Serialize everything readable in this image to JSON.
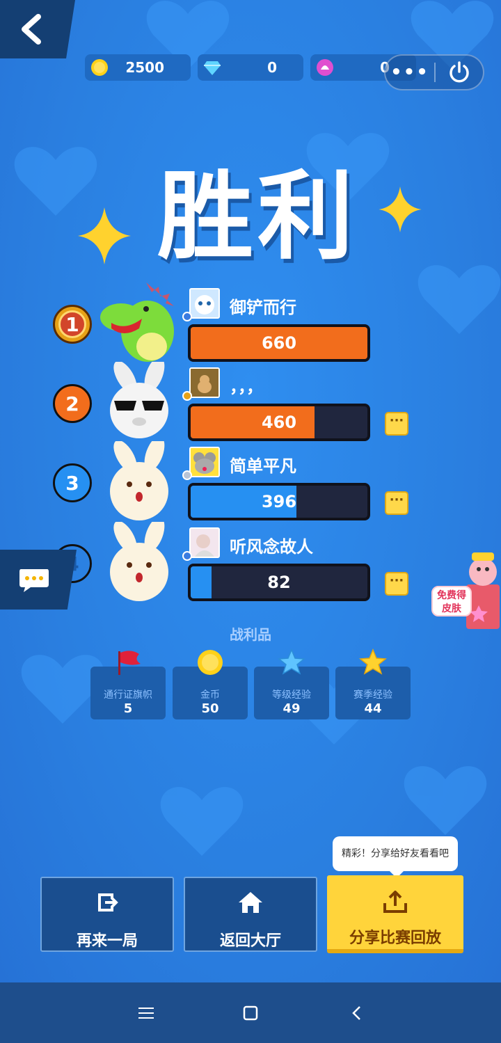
{
  "currencies": [
    {
      "icon": "gold-coin-icon",
      "value": "2500",
      "color": "#ffd11a"
    },
    {
      "icon": "diamond-icon",
      "value": "0",
      "color": "#5fd5ff"
    },
    {
      "icon": "flower-icon",
      "value": "0",
      "color": "#e04fd0"
    }
  ],
  "title": "胜利",
  "players": [
    {
      "rank": "1",
      "name": "御铲而行",
      "score": "660",
      "progress": 1.0,
      "bar_color": "#f26d1c",
      "rank_color": "#e6a117",
      "level_color": "#3a7be0",
      "mascot": "dinosaur-mascot"
    },
    {
      "rank": "2",
      "name": "，，，",
      "score": "460",
      "progress": 0.7,
      "bar_color": "#f26d1c",
      "rank_color": "#f26d1c",
      "level_color": "#e8a216",
      "mascot": "bunny-sunglasses-mascot"
    },
    {
      "rank": "3",
      "name": "简单平凡",
      "score": "396",
      "progress": 0.6,
      "bar_color": "#2690f2",
      "rank_color": "#2690f2",
      "level_color": "#b9c4d6",
      "mascot": "bunny-mascot"
    },
    {
      "rank": "4",
      "name": "听风念故人",
      "score": "82",
      "progress": 0.12,
      "bar_color": "#2690f2",
      "rank_color": "#2a7fe0",
      "level_color": "#3a7be0",
      "mascot": "bunny-mascot"
    }
  ],
  "options_label": "···",
  "free_skin": "免费得皮肤",
  "loot": {
    "title": "战利品",
    "items": [
      {
        "icon": "flag-icon",
        "label": "通行证旗帜",
        "value": "5"
      },
      {
        "icon": "gold-coin-icon",
        "label": "金币",
        "value": "50"
      },
      {
        "icon": "blue-star-icon",
        "label": "等级经验",
        "value": "49"
      },
      {
        "icon": "yellow-star-icon",
        "label": "赛季经验",
        "value": "44"
      }
    ]
  },
  "buttons": {
    "replay": "再来一局",
    "lobby": "返回大厅",
    "share": "分享比赛回放",
    "share_tip": "精彩！分享给好友看看吧"
  }
}
